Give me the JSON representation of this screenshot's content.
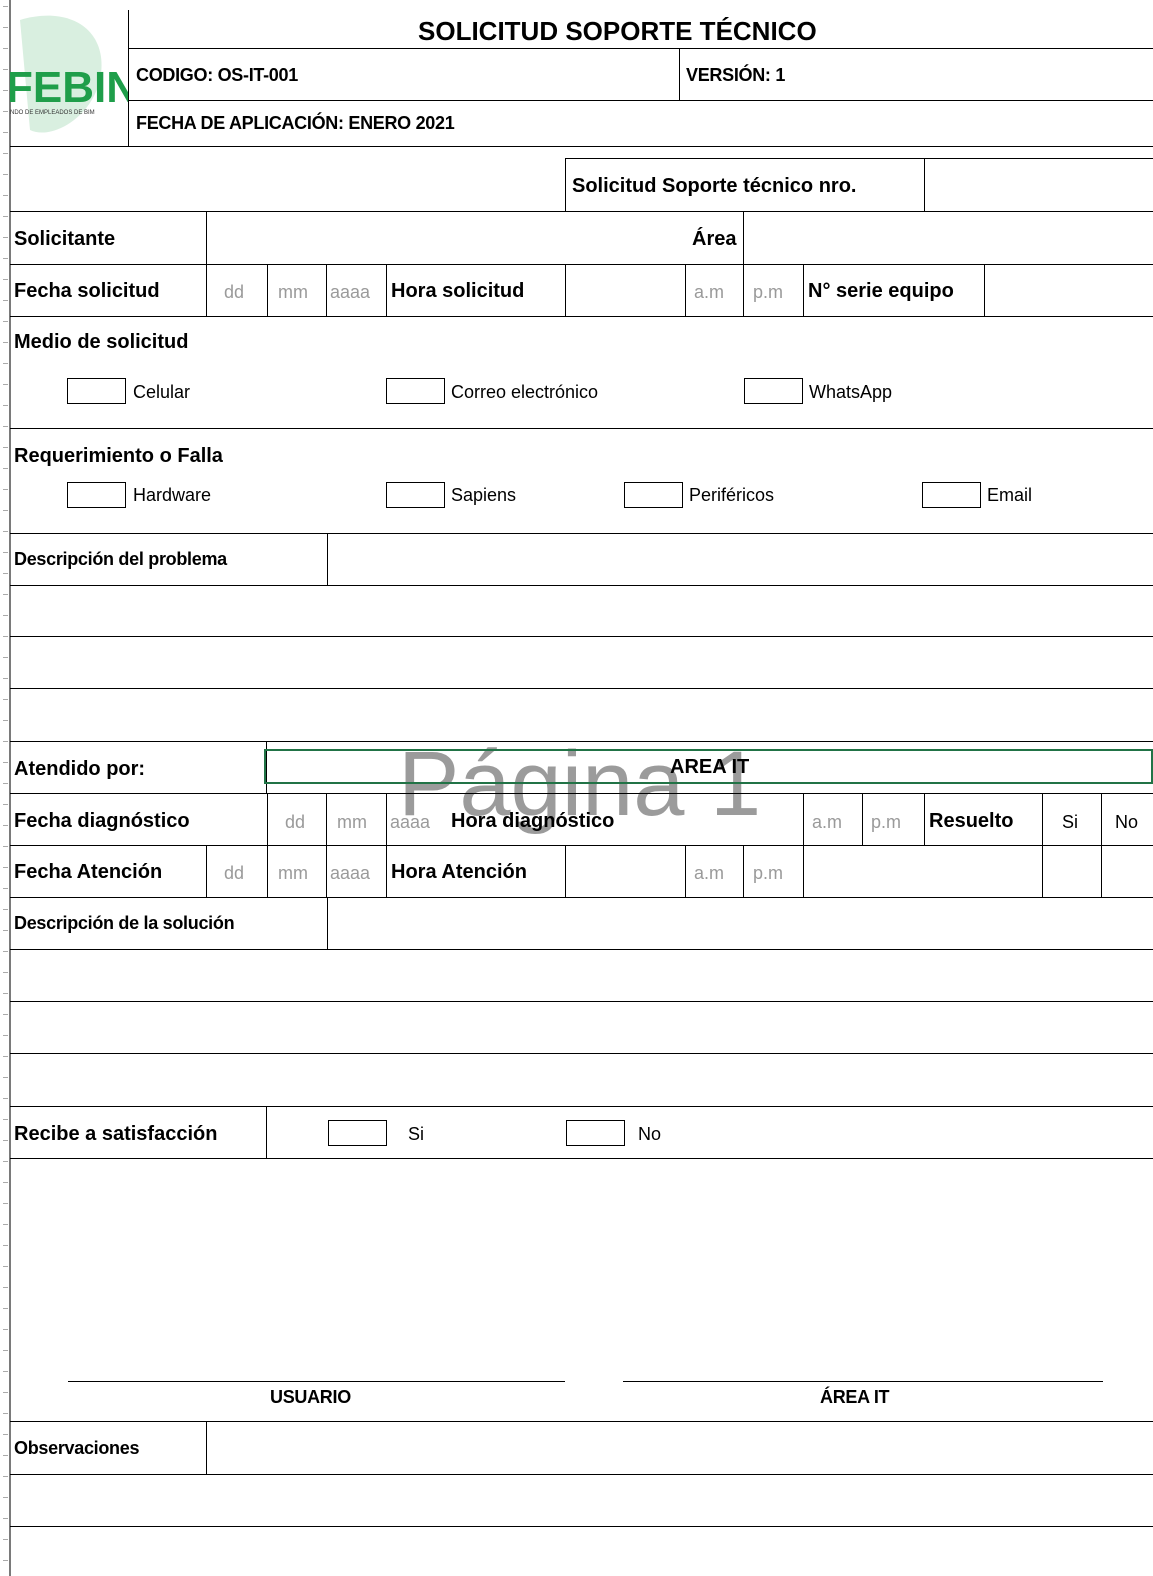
{
  "header": {
    "title": "SOLICITUD SOPORTE TÉCNICO",
    "codigo": "CODIGO: OS-IT-001",
    "version": "VERSIÓN: 1",
    "fecha_aplicacion": "FECHA DE APLICACIÓN: ENERO 2021",
    "logo_text": "FEBIN",
    "logo_subtext": "NDO DE EMPLEADOS DE BIM"
  },
  "request_no_label": "Solicitud  Soporte técnico nro.",
  "row_solicitante": {
    "label": "Solicitante",
    "area_label": "Área"
  },
  "row_fecha_solicitud": {
    "label": "Fecha solicitud",
    "dd": "dd",
    "mm": "mm",
    "aaaa": "aaaa",
    "hora_label": "Hora solicitud",
    "am": "a.m",
    "pm": "p.m",
    "serie_label": "N° serie equipo"
  },
  "medio": {
    "title": "Medio de solicitud",
    "options": [
      "Celular",
      "Correo electrónico",
      "WhatsApp"
    ]
  },
  "requerimiento": {
    "title": "Requerimiento o Falla",
    "options": [
      "Hardware",
      "Sapiens",
      "Periféricos",
      "Email"
    ]
  },
  "descripcion_problema": "Descripción del problema",
  "atendido": {
    "label": "Atendido por:",
    "value": "AREA IT"
  },
  "watermark": "Página 1",
  "row_diagnostico": {
    "label": "Fecha diagnóstico",
    "dd": "dd",
    "mm": "mm",
    "aaaa": "aaaa",
    "hora_label": "Hora diagnóstico",
    "am": "a.m",
    "pm": "p.m",
    "resuelto_label": "Resuelto",
    "si": "Si",
    "no": "No"
  },
  "row_atencion": {
    "label": "Fecha Atención",
    "dd": "dd",
    "mm": "mm",
    "aaaa": "aaaa",
    "hora_label": "Hora Atención",
    "am": "a.m",
    "pm": "p.m"
  },
  "descripcion_solucion": "Descripción de la solución",
  "satisfaccion": {
    "label": "Recibe a satisfacción",
    "si": "Si",
    "no": "No"
  },
  "firmas": {
    "usuario": "USUARIO",
    "area_it": "ÁREA IT"
  },
  "observaciones": "Observaciones",
  "colors": {
    "selection": "#217346",
    "placeholder": "#9a9a9a",
    "logo_green": "#1f9e4a"
  }
}
